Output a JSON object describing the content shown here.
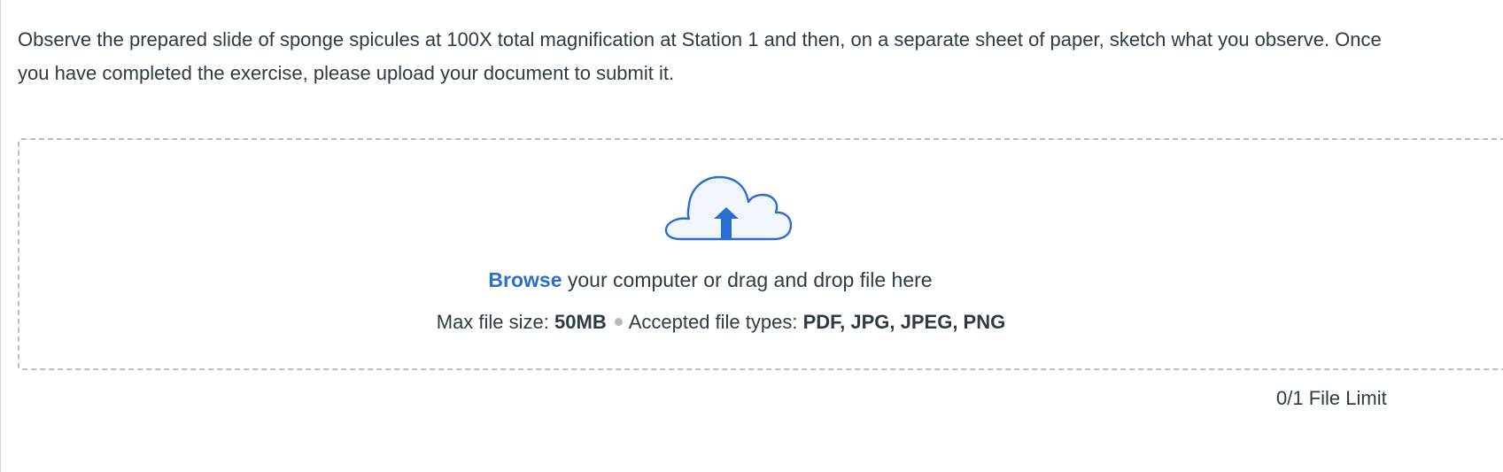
{
  "instructions": {
    "text": "Observe the prepared slide of sponge spicules at 100X total magnification at Station 1 and then, on a separate sheet of paper, sketch what you observe. Once you have completed the exercise, please upload your document to submit it."
  },
  "upload": {
    "icon": "cloud-upload-icon",
    "browse_label": "Browse",
    "browse_suffix": " your computer or drag and drop file here",
    "max_size_label": "Max file size: ",
    "max_size_value": "50MB",
    "types_label": "Accepted file types: ",
    "types_value": "PDF, JPG, JPEG, PNG",
    "file_limit": "0/1 File Limit"
  },
  "colors": {
    "link": "#2b6ed2",
    "text": "#2d3b45",
    "border": "#b8bec4",
    "icon_fill": "#f0f6fc",
    "icon_stroke": "#2b6ed2"
  }
}
